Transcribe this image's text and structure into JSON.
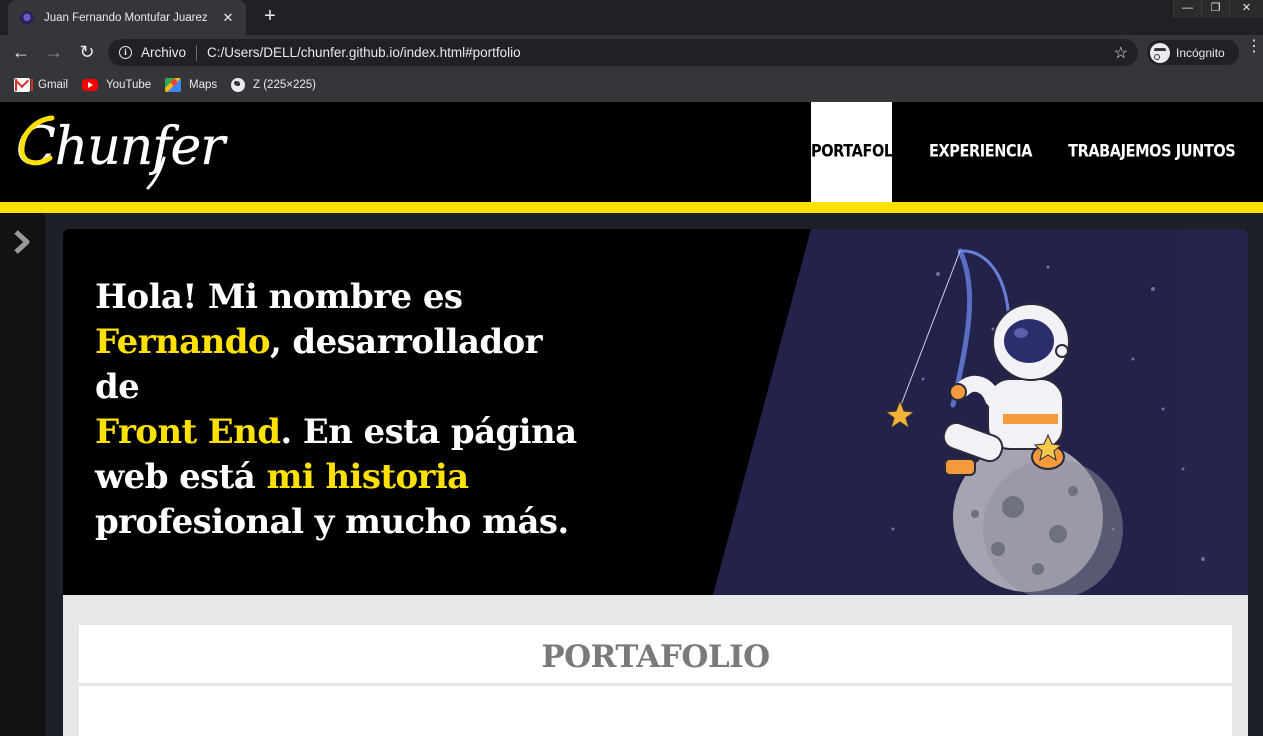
{
  "browser": {
    "tab": {
      "title": "Juan Fernando Montufar Juarez",
      "close": "✕"
    },
    "new_tab": "+",
    "window_controls": {
      "minimize": "—",
      "restore": "❐",
      "close": "✕"
    },
    "nav": {
      "back": "←",
      "forward": "→",
      "reload": "↻"
    },
    "omnibox": {
      "origin_label": "Archivo",
      "url": "C:/Users/DELL/chunfer.github.io/index.html#portfolio",
      "info_icon": "i",
      "star": "☆"
    },
    "profile_label": "Incógnito",
    "menu": "⋮",
    "bookmarks": [
      {
        "label": "Gmail",
        "icon": "gmail-icon"
      },
      {
        "label": "YouTube",
        "icon": "youtube-icon"
      },
      {
        "label": "Maps",
        "icon": "maps-icon"
      },
      {
        "label": "Z (225×225)",
        "icon": "globe-icon"
      }
    ]
  },
  "site": {
    "logo_text": "Chunfer",
    "nav": [
      {
        "label": "PORTAFOLIO",
        "active": true
      },
      {
        "label": "EXPERIENCIA",
        "active": false
      },
      {
        "label": "TRABAJEMOS JUNTOS",
        "active": false
      }
    ],
    "colors": {
      "accent": "#ffe100",
      "header_bg": "#000000",
      "hero_panel": "#23224a"
    },
    "hero": {
      "line1": "Hola! Mi nombre es",
      "line2_hl": "Fernando",
      "line2_rest": ", desarrollador de",
      "line3_hl": "Front End",
      "line3_rest": ". En esta página",
      "line4_pre": "web está ",
      "line4_hl": "mi historia",
      "line5": "profesional y mucho más."
    },
    "section": {
      "title": "PORTAFOLIO"
    }
  }
}
